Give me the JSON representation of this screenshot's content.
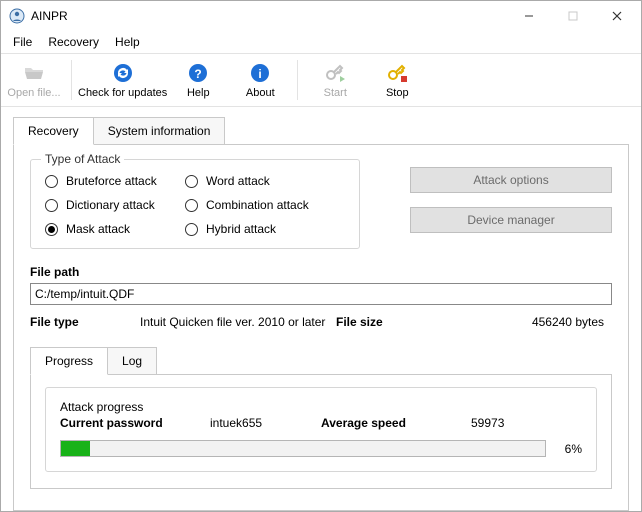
{
  "window": {
    "title": "AINPR"
  },
  "menu": {
    "file": "File",
    "recovery": "Recovery",
    "help": "Help"
  },
  "toolbar": {
    "open": "Open file...",
    "update": "Check for updates",
    "help": "Help",
    "about": "About",
    "start": "Start",
    "stop": "Stop"
  },
  "tabs": {
    "recovery": "Recovery",
    "sysinfo": "System information"
  },
  "attack": {
    "legend": "Type of Attack",
    "bruteforce": "Bruteforce attack",
    "dictionary": "Dictionary attack",
    "mask": "Mask attack",
    "word": "Word attack",
    "combination": "Combination attack",
    "hybrid": "Hybrid attack",
    "selected": "mask"
  },
  "sidebuttons": {
    "options": "Attack options",
    "devicemgr": "Device manager"
  },
  "file": {
    "path_label": "File path",
    "path_value": "C:/temp/intuit.QDF",
    "type_label": "File type",
    "type_value": "Intuit Quicken file ver. 2010 or later",
    "size_label": "File size",
    "size_value": "456240 bytes"
  },
  "subtabs": {
    "progress": "Progress",
    "log": "Log"
  },
  "progress": {
    "legend": "Attack progress",
    "current_label": "Current password",
    "current_value": "intuek655",
    "speed_label": "Average speed",
    "speed_value": "59973",
    "percent_text": "6%",
    "percent_css": "width:6%"
  }
}
